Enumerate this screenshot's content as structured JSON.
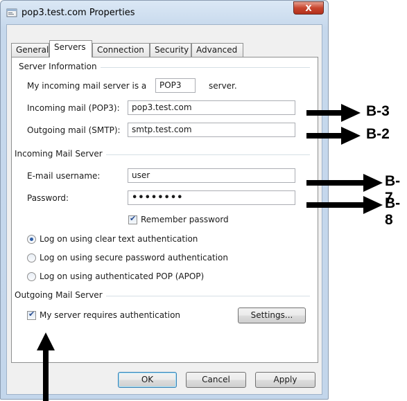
{
  "window": {
    "title": "pop3.test.com Properties",
    "close_glyph": "X"
  },
  "tabs": [
    {
      "label": "General",
      "active": false
    },
    {
      "label": "Servers",
      "active": true
    },
    {
      "label": "Connection",
      "active": false
    },
    {
      "label": "Security",
      "active": false
    },
    {
      "label": "Advanced",
      "active": false
    }
  ],
  "server_info": {
    "group_label": "Server Information",
    "incoming_prefix": "My incoming mail server is a",
    "server_type": "POP3",
    "incoming_suffix": "server.",
    "incoming_label": "Incoming mail (POP3):",
    "incoming_value": "pop3.test.com",
    "outgoing_label": "Outgoing mail (SMTP):",
    "outgoing_value": "smtp.test.com"
  },
  "incoming_server": {
    "group_label": "Incoming Mail Server",
    "username_label": "E-mail username:",
    "username_value": "user",
    "password_label": "Password:",
    "password_value": "••••••••",
    "remember_label": "Remember password",
    "remember_checked": true,
    "auth_options": [
      {
        "label": "Log on using clear text authentication",
        "selected": true
      },
      {
        "label": "Log on using secure password authentication",
        "selected": false
      },
      {
        "label": "Log on using authenticated POP (APOP)",
        "selected": false
      }
    ]
  },
  "outgoing_server": {
    "group_label": "Outgoing Mail Server",
    "requires_auth_label": "My server requires authentication",
    "requires_auth_checked": true,
    "settings_button": "Settings..."
  },
  "buttons": {
    "ok": "OK",
    "cancel": "Cancel",
    "apply": "Apply"
  },
  "annotations": {
    "incoming": "B-3",
    "outgoing": "B-2",
    "username": "B-7",
    "password": "B-8"
  }
}
